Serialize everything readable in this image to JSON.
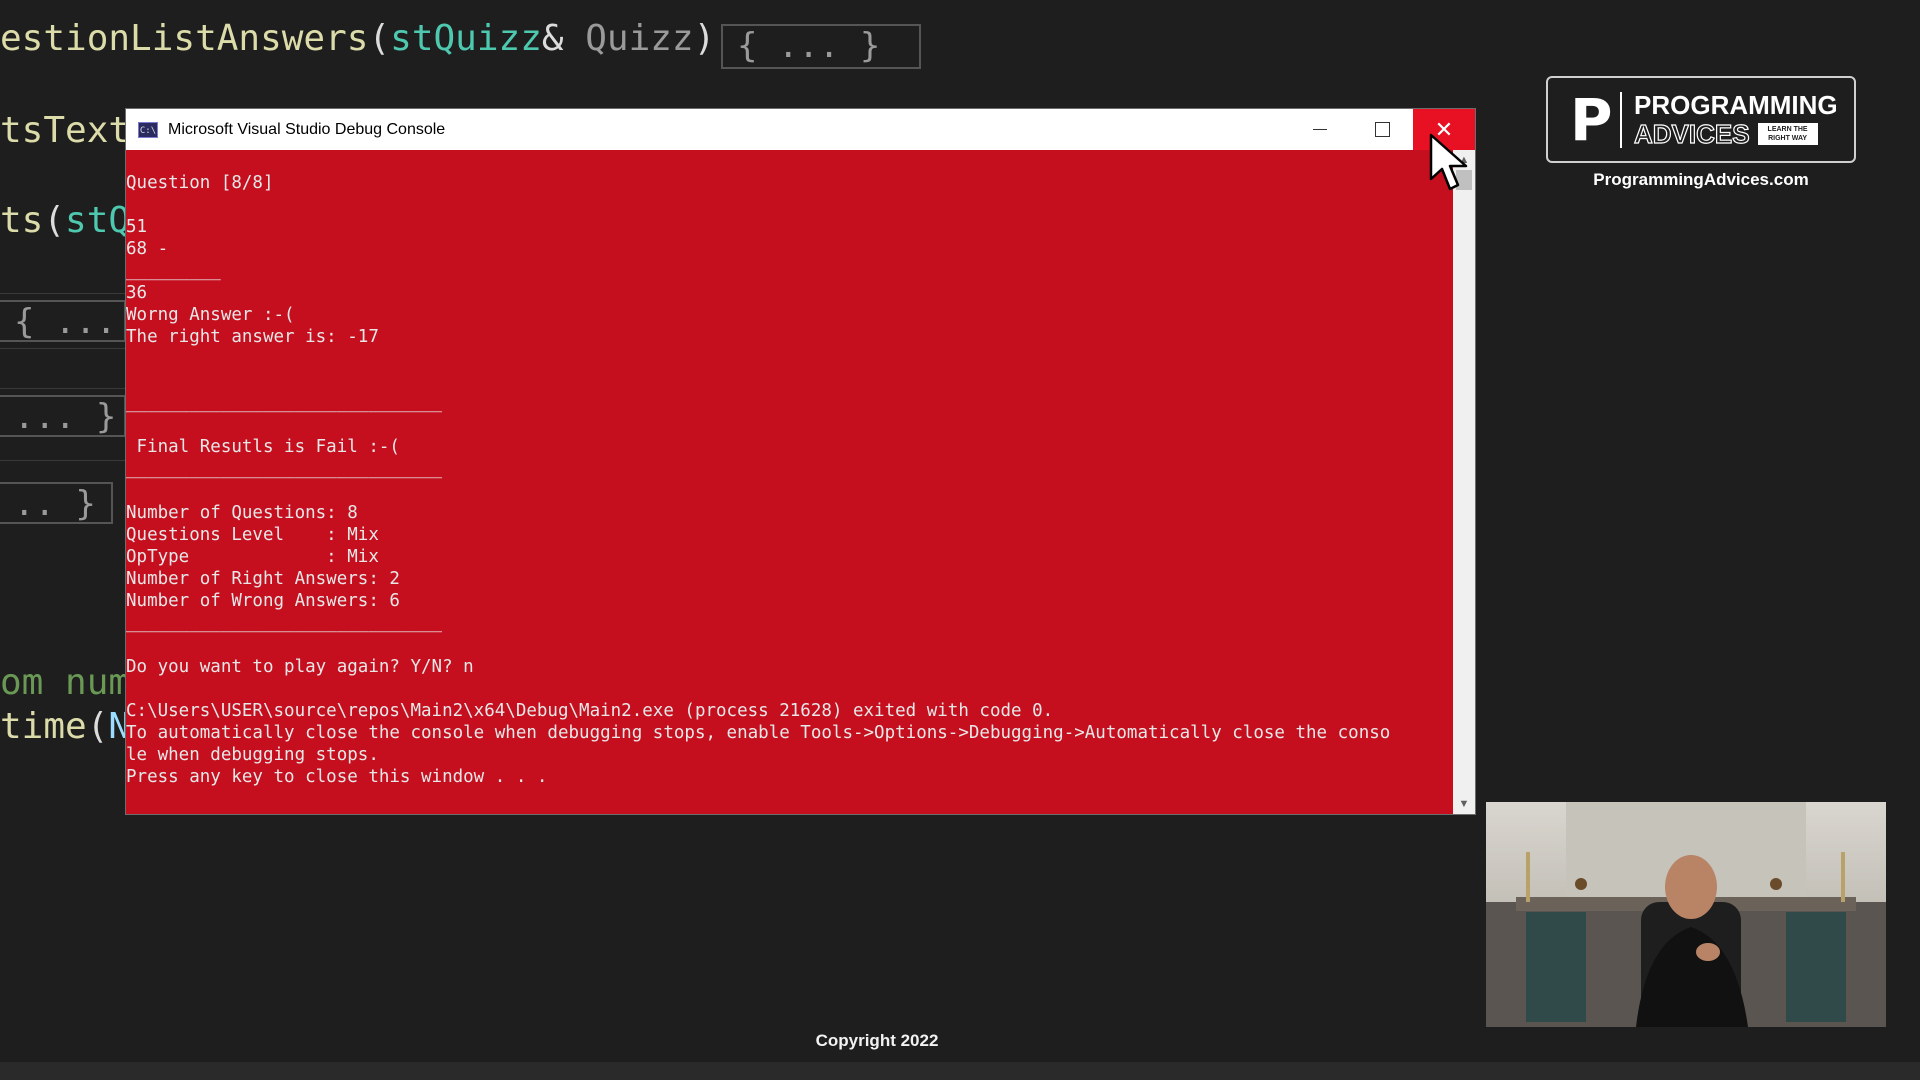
{
  "editor": {
    "line1": {
      "func": "estionListAnswers",
      "open": "(",
      "type": "stQuizz",
      "amp": "& ",
      "param": "Quizz",
      "close": ")"
    },
    "line1_collapsed": "{ ... }",
    "line2": "tsText",
    "line3": {
      "func": "ts",
      "open": "(",
      "type": "stQ"
    },
    "fold1": "{ ...",
    "fold2": "... }",
    "fold3": ".. }",
    "line4": "om num",
    "line5": {
      "func": "time",
      "open": "(",
      "param": "N"
    }
  },
  "console": {
    "title": "Microsoft Visual Studio Debug Console",
    "icon_label": "C:\\",
    "lines": [
      "",
      "Question [8/8]",
      "",
      "51",
      "68 -",
      "_________",
      "36",
      "Worng Answer :-(",
      "The right answer is: -17",
      "",
      "",
      "______________________________",
      "",
      " Final Resutls is Fail :-(",
      "______________________________",
      "",
      "Number of Questions: 8",
      "Questions Level    : Mix",
      "OpType             : Mix",
      "Number of Right Answers: 2",
      "Number of Wrong Answers: 6",
      "______________________________",
      "",
      "Do you want to play again? Y/N? n",
      "",
      "C:\\Users\\USER\\source\\repos\\Main2\\x64\\Debug\\Main2.exe (process 21628) exited with code 0.",
      "To automatically close the console when debugging stops, enable Tools->Options->Debugging->Automatically close the conso",
      "le when debugging stops.",
      "Press any key to close this window . . ."
    ],
    "background_color": "#c50f1f"
  },
  "branding": {
    "logo_letter": "P",
    "logo_word1": "PROGRAMMING",
    "logo_word2": "ADVICES",
    "logo_tagline": "LEARN THE RIGHT WAY",
    "site": "ProgrammingAdvices.com"
  },
  "footer": {
    "copyright": "Copyright 2022"
  },
  "icons": {
    "app": "console-app-icon",
    "minimize": "minimize-icon",
    "maximize": "maximize-icon",
    "close": "close-icon",
    "cursor": "mouse-pointer-icon"
  }
}
